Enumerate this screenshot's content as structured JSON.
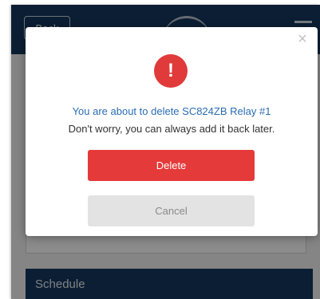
{
  "app": {
    "back_label": "Back",
    "schedule_label": "Schedule"
  },
  "modal": {
    "close_glyph": "×",
    "alert_glyph": "!",
    "message_primary": "You are about to delete SC824ZB Relay #1",
    "message_secondary": "Don't worry, you can always add it back later.",
    "delete_label": "Delete",
    "cancel_label": "Cancel"
  },
  "colors": {
    "header": "#15385e",
    "danger": "#e53a3a",
    "link_blue": "#2a6cb3",
    "cancel_bg": "#e3e3e3"
  },
  "icons": [
    "close-icon",
    "alert-icon",
    "menu-icon"
  ]
}
